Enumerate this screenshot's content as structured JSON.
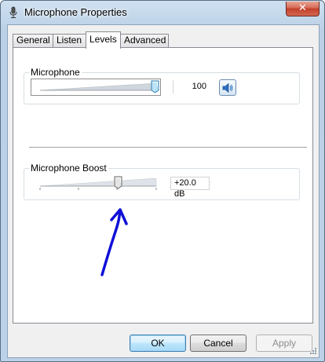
{
  "window": {
    "title": "Microphone Properties",
    "close_symbol": "✕"
  },
  "tabs": [
    {
      "label": "General",
      "active": false
    },
    {
      "label": "Listen",
      "active": false
    },
    {
      "label": "Levels",
      "active": true
    },
    {
      "label": "Advanced",
      "active": false
    }
  ],
  "levels": {
    "microphone": {
      "label": "Microphone",
      "value": "100",
      "level_percent": 100,
      "speaker_icon": "speaker-icon"
    },
    "boost": {
      "label": "Microphone Boost",
      "value": "+20.0 dB",
      "level_fraction": 0.67
    }
  },
  "annotation": {
    "arrow_color": "#1010d8"
  },
  "buttons": {
    "ok": "OK",
    "cancel": "Cancel",
    "apply": "Apply"
  }
}
